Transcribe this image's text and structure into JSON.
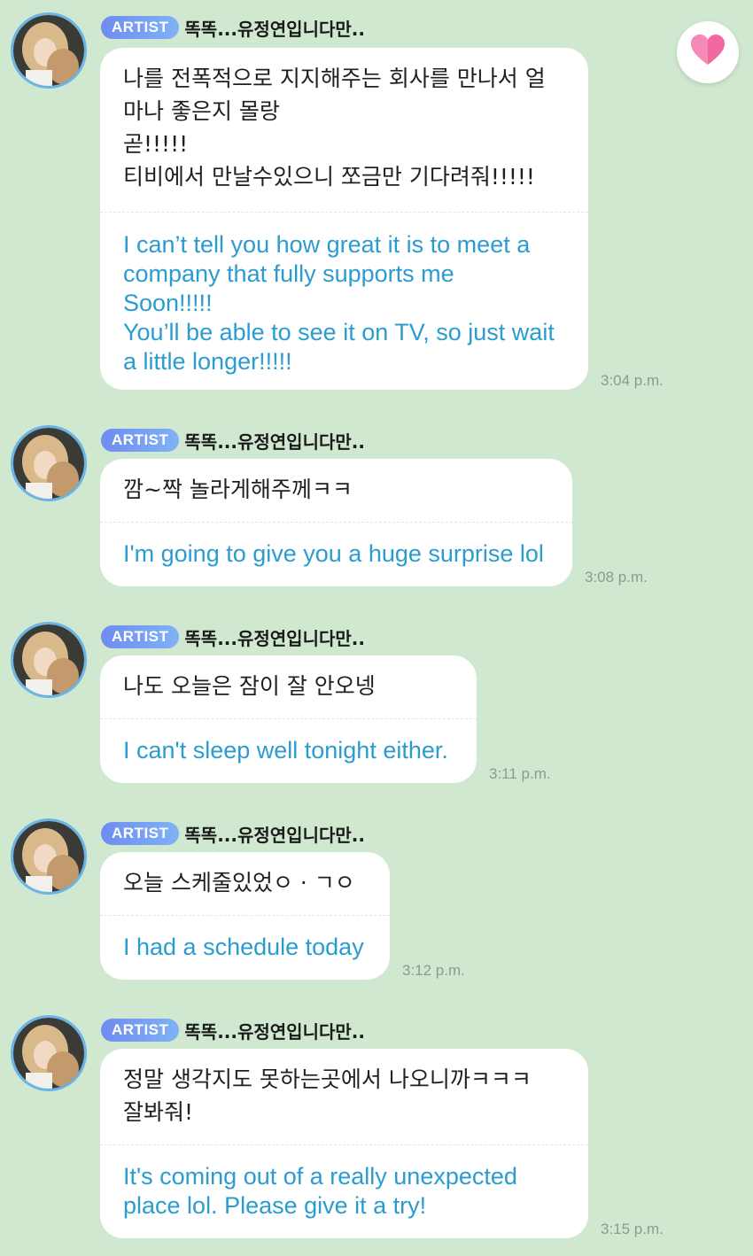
{
  "colors": {
    "background": "#cfe8cf",
    "bubble": "#ffffff",
    "translation_text": "#2b9ccf",
    "badge_start": "#6f8cf2",
    "badge_end": "#7fb2f4",
    "heart": "#f06aa0"
  },
  "heart_button": {
    "icon": "heart-icon"
  },
  "messages": [
    {
      "badge": "ARTIST",
      "sender": "똑똑...유정연입니다만..",
      "korean": "나를 전폭적으로 지지해주는 회사를 만나서 얼\n마나 좋은지 몰랑\n곧!!!!!\n티비에서 만날수있으니 쪼금만 기다려줘!!!!!",
      "english": "I can’t tell you how great it is to meet a\ncompany that fully supports me\nSoon!!!!!\nYou’ll be able to see it on TV, so just wait\na little longer!!!!!",
      "time": "3:04 p.m."
    },
    {
      "badge": "ARTIST",
      "sender": "똑똑...유정연입니다만..",
      "korean": "깜~짝 놀라게해주께ㅋㅋ",
      "english": "I'm going to give you a huge surprise lol",
      "time": "3:08 p.m."
    },
    {
      "badge": "ARTIST",
      "sender": "똑똑...유정연입니다만..",
      "korean": "나도 오늘은 잠이 잘 안오넹",
      "english": "I can't sleep well tonight either.",
      "time": "3:11 p.m."
    },
    {
      "badge": "ARTIST",
      "sender": "똑똑...유정연입니다만..",
      "korean": "오늘 스케줄있었ㅇ · ㄱㅇ",
      "english": "I had a schedule today",
      "time": "3:12 p.m."
    },
    {
      "badge": "ARTIST",
      "sender": "똑똑...유정연입니다만..",
      "korean": "정말 생각지도 못하는곳에서 나오니까ㅋㅋㅋ\n잘봐줘!",
      "english": "It's coming out of a really unexpected\nplace lol. Please give it a try!",
      "time": "3:15 p.m."
    }
  ]
}
